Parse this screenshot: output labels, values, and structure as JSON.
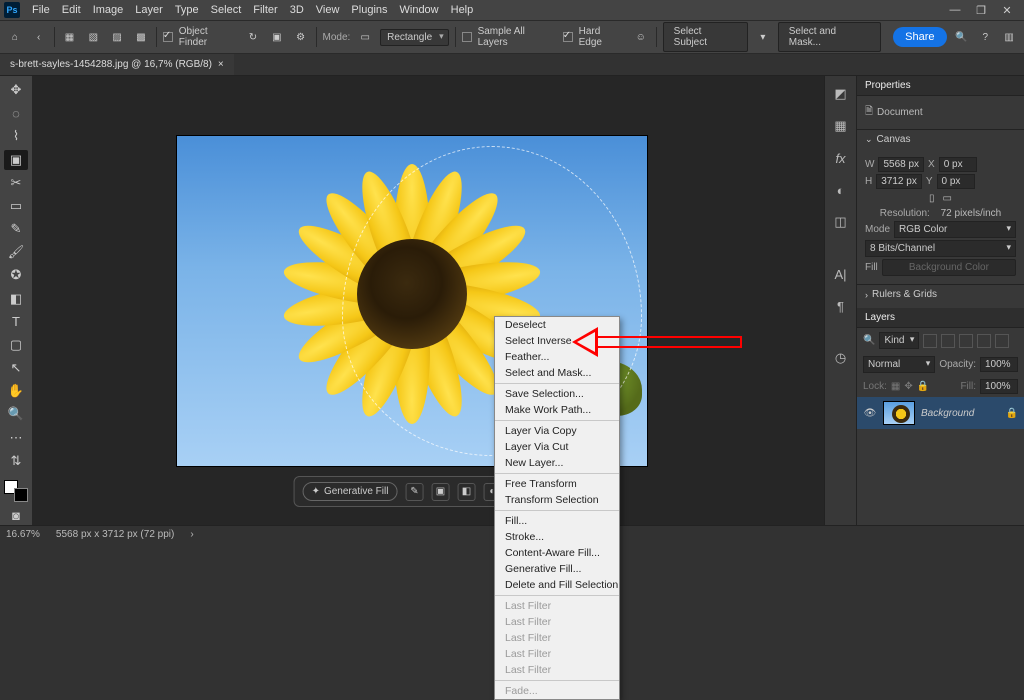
{
  "menu": {
    "items": [
      "File",
      "Edit",
      "Image",
      "Layer",
      "Type",
      "Select",
      "Filter",
      "3D",
      "View",
      "Plugins",
      "Window",
      "Help"
    ]
  },
  "options": {
    "object_finder": "Object Finder",
    "mode_label": "Mode:",
    "mode_value": "Rectangle",
    "sample_all": "Sample All Layers",
    "hard_edge": "Hard Edge",
    "select_subject": "Select Subject",
    "select_mask": "Select and Mask...",
    "share": "Share"
  },
  "doc": {
    "tab_title": "s-brett-sayles-1454288.jpg @ 16,7% (RGB/8)"
  },
  "ctxbar": {
    "gen_fill": "Generative Fill"
  },
  "context_menu": {
    "g1": [
      "Deselect",
      "Select Inverse",
      "Feather...",
      "Select and Mask..."
    ],
    "g2": [
      "Save Selection...",
      "Make Work Path..."
    ],
    "g3": [
      "Layer Via Copy",
      "Layer Via Cut",
      "New Layer..."
    ],
    "g4": [
      "Free Transform",
      "Transform Selection"
    ],
    "g5": [
      "Fill...",
      "Stroke...",
      "Content-Aware Fill...",
      "Generative Fill...",
      "Delete and Fill Selection"
    ],
    "g6": [
      "Last Filter",
      "Last Filter",
      "Last Filter",
      "Last Filter",
      "Last Filter"
    ],
    "g7": [
      "Fade..."
    ]
  },
  "properties": {
    "title": "Properties",
    "doc_label": "Document",
    "canvas": "Canvas",
    "w_label": "W",
    "w_val": "5568 px",
    "h_label": "H",
    "h_val": "3712 px",
    "x_label": "X",
    "x_val": "0 px",
    "y_label": "Y",
    "y_val": "0 px",
    "res_label": "Resolution:",
    "res_val": "72 pixels/inch",
    "mode_label": "Mode",
    "mode_val": "RGB Color",
    "bits_val": "8 Bits/Channel",
    "fill_label": "Fill",
    "fill_val": "Background Color",
    "rulers": "Rulers & Grids"
  },
  "layers": {
    "title": "Layers",
    "kind": "Kind",
    "blend": "Normal",
    "opacity_label": "Opacity:",
    "opacity_val": "100%",
    "lock_label": "Lock:",
    "fill_label": "Fill:",
    "fill_val": "100%",
    "layer_name": "Background"
  },
  "status": {
    "zoom": "16.67%",
    "dims": "5568 px x 3712 px (72 ppi)"
  }
}
